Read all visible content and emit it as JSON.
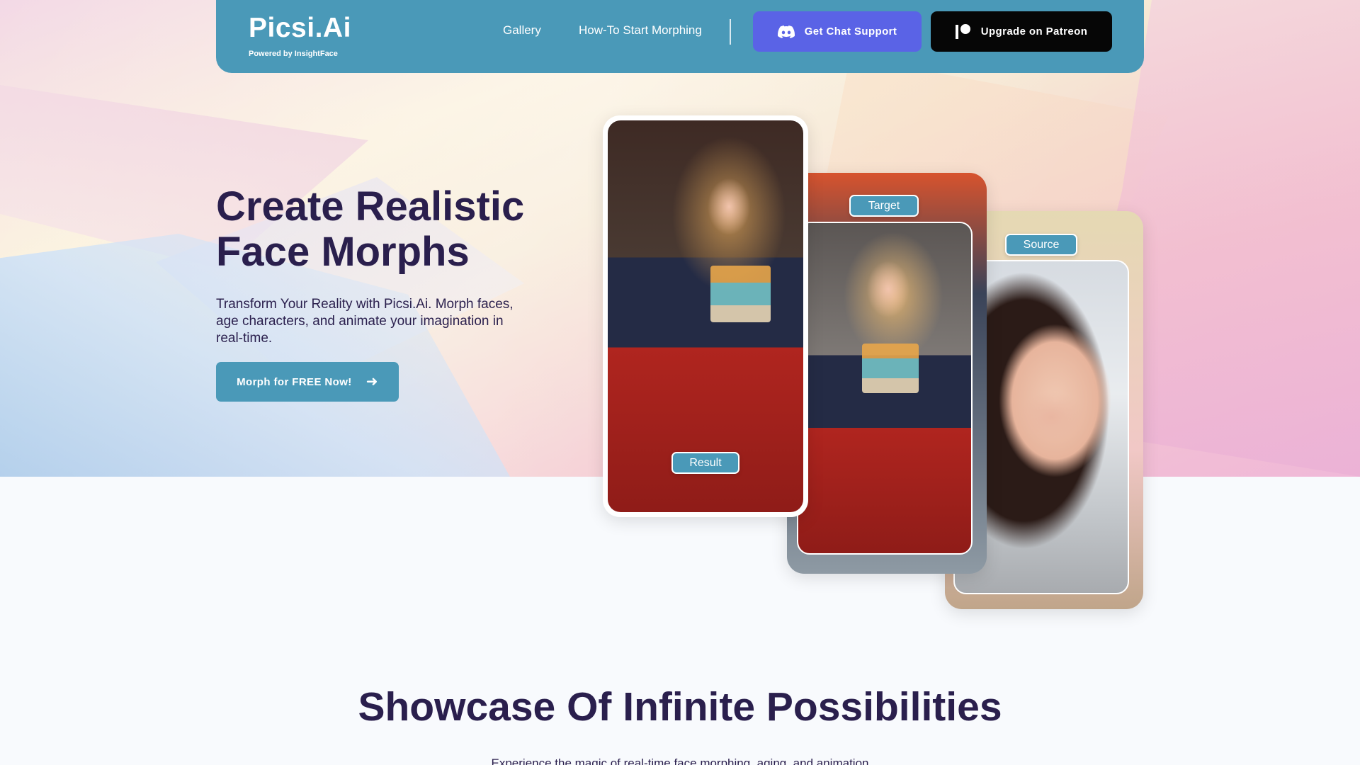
{
  "header": {
    "brand": "Picsi.Ai",
    "brand_sub": "Powered by InsightFace",
    "nav": {
      "gallery": "Gallery",
      "howto": "How-To Start Morphing"
    },
    "discord_button": "Get Chat Support",
    "patreon_button": "Upgrade on Patreon"
  },
  "hero": {
    "title_line1": "Create Realistic",
    "title_line2": "Face Morphs",
    "description": "Transform Your Reality with Picsi.Ai. Morph faces, age characters, and animate your imagination in real-time.",
    "cta": "Morph for FREE Now!",
    "cards": {
      "result_label": "Result",
      "target_label": "Target",
      "source_label": "Source"
    }
  },
  "showcase": {
    "title": "Showcase Of Infinite Possibilities",
    "subtitle": "Experience the magic of real-time face morphing, aging, and animation"
  },
  "colors": {
    "brand": "#4a99b8",
    "discord": "#5a63e6",
    "patreon": "#060606",
    "heading": "#2a1f4d"
  }
}
